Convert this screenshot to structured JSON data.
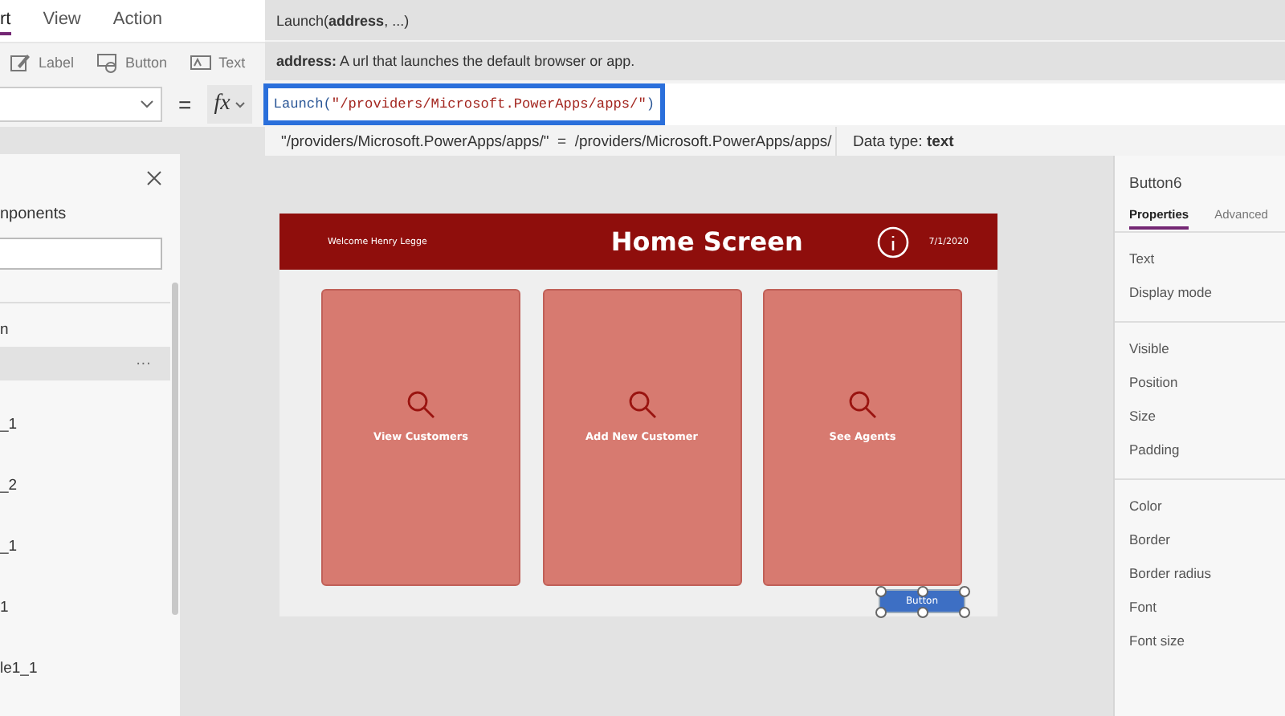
{
  "menu": {
    "tabs": [
      {
        "label": "rt",
        "selected": true
      },
      {
        "label": "View",
        "selected": false
      },
      {
        "label": "Action",
        "selected": false
      }
    ]
  },
  "toolbar": {
    "items": [
      {
        "kind": "label",
        "label": "Label"
      },
      {
        "kind": "button",
        "label": "Button"
      },
      {
        "kind": "text",
        "label": "Text"
      }
    ]
  },
  "tooltip": {
    "signature": "Launch(**address**, ...)",
    "description": "**address:** A url that launches the default browser or app."
  },
  "formula_bar": {
    "equals": "=",
    "fx": "fx",
    "formula": [
      {
        "kind": "function",
        "text": "Launch("
      },
      {
        "kind": "string",
        "text": "\"/providers/Microsoft.PowerApps/apps/\""
      },
      {
        "kind": "function",
        "text": ")"
      }
    ]
  },
  "result": {
    "preview": "\"/providers/Microsoft.PowerApps/apps/\"  =  /providers/Microsoft.PowerApps/apps/",
    "data_type": "Data type: **text**"
  },
  "tree_panel": {
    "title": "nponents",
    "items": [
      {
        "label": "n",
        "selected": false
      },
      {
        "more": "···",
        "selected": true
      },
      {
        "label": "_1",
        "selected": false
      },
      {
        "label": "_2",
        "selected": false
      },
      {
        "label": "_1",
        "selected": false
      },
      {
        "label": "1",
        "selected": false
      },
      {
        "label": "le1_1",
        "selected": false
      }
    ]
  },
  "screen": {
    "welcome": "Welcome Henry Legge",
    "title": "Home Screen",
    "date": "7/1/2020",
    "cards": [
      {
        "label": "View Customers"
      },
      {
        "label": "Add New Customer"
      },
      {
        "label": "See Agents"
      }
    ],
    "button": {
      "label": "Button",
      "selected": true
    }
  },
  "properties": {
    "control_name": "Button6",
    "tabs": [
      {
        "label": "Properties",
        "selected": true
      },
      {
        "label": "Advanced",
        "selected": false
      }
    ],
    "groups": [
      [
        "Text",
        "Display mode"
      ],
      [
        "Visible",
        "Position",
        "Size",
        "Padding"
      ],
      [
        "Color",
        "Border",
        "Border radius",
        "Font",
        "Font size"
      ]
    ]
  }
}
